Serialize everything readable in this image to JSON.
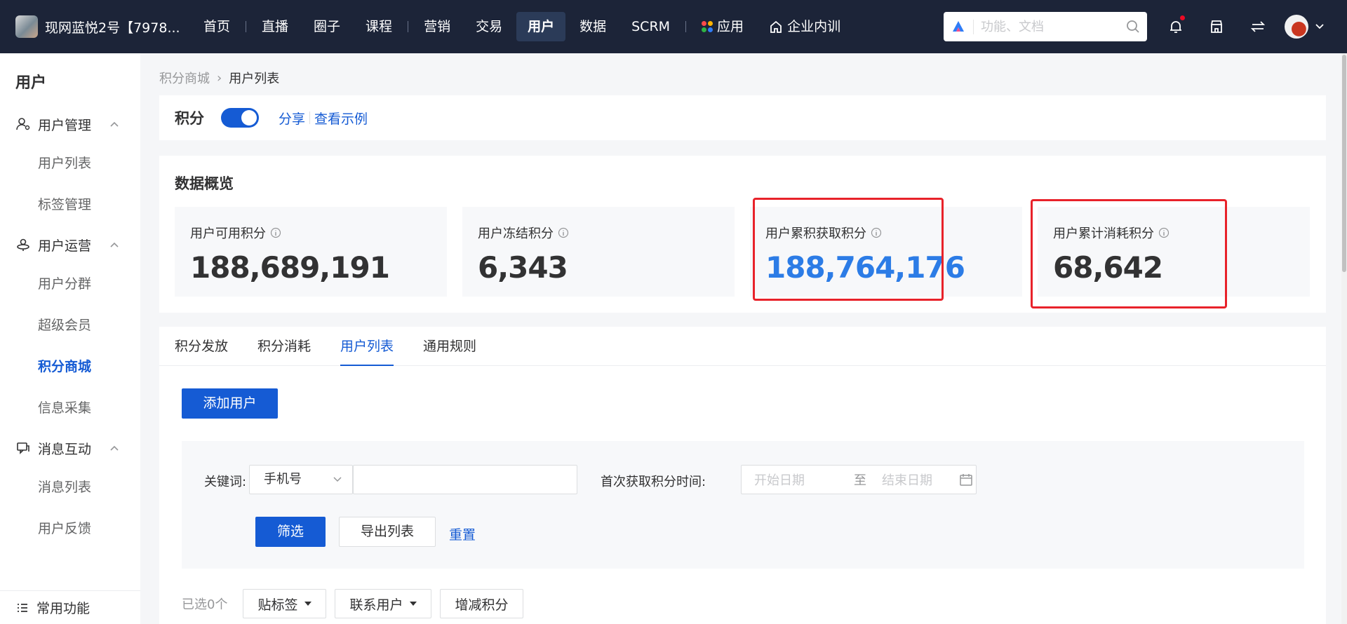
{
  "topbar": {
    "shop_name": "现网蓝悦2号【7978...",
    "nav": [
      "首页",
      "直播",
      "圈子",
      "课程",
      "营销",
      "交易",
      "用户",
      "数据",
      "SCRM",
      "应用",
      "企业内训"
    ],
    "active_nav": "用户",
    "search_placeholder": "功能、文档"
  },
  "sidebar": {
    "title": "用户",
    "groups": [
      {
        "label": "用户管理",
        "items": [
          "用户列表",
          "标签管理"
        ]
      },
      {
        "label": "用户运营",
        "items": [
          "用户分群",
          "超级会员",
          "积分商城",
          "信息采集"
        ]
      },
      {
        "label": "消息互动",
        "items": [
          "消息列表",
          "用户反馈"
        ]
      }
    ],
    "active_item": "积分商城",
    "bottom": "常用功能"
  },
  "breadcrumb": {
    "parent": "积分商城",
    "current": "用户列表"
  },
  "points_bar": {
    "title": "积分",
    "toggle_on": true,
    "share": "分享",
    "example": "查看示例"
  },
  "overview": {
    "title": "数据概览",
    "stats": [
      {
        "label": "用户可用积分",
        "value": "188,689,191"
      },
      {
        "label": "用户冻结积分",
        "value": "6,343"
      },
      {
        "label": "用户累积获取积分",
        "value": "188,764,176"
      },
      {
        "label": "用户累计消耗积分",
        "value": "68,642"
      }
    ]
  },
  "tabs": [
    "积分发放",
    "积分消耗",
    "用户列表",
    "通用规则"
  ],
  "active_tab": "用户列表",
  "add_user": "添加用户",
  "filter": {
    "keyword_label": "关键词:",
    "keyword_type": "手机号",
    "keyword_value": "",
    "date_label": "首次获取积分时间:",
    "start_placeholder": "开始日期",
    "to": "至",
    "end_placeholder": "结束日期",
    "filter_btn": "筛选",
    "export_btn": "导出列表",
    "reset": "重置"
  },
  "batch": {
    "selected": "已选0个",
    "tag": "贴标签",
    "contact": "联系用户",
    "adjust": "增减积分"
  },
  "colors": {
    "topbar": "#1c2438",
    "primary": "#155bd4",
    "highlight": "#e8222a",
    "stat_blue": "#2c7ce6"
  }
}
